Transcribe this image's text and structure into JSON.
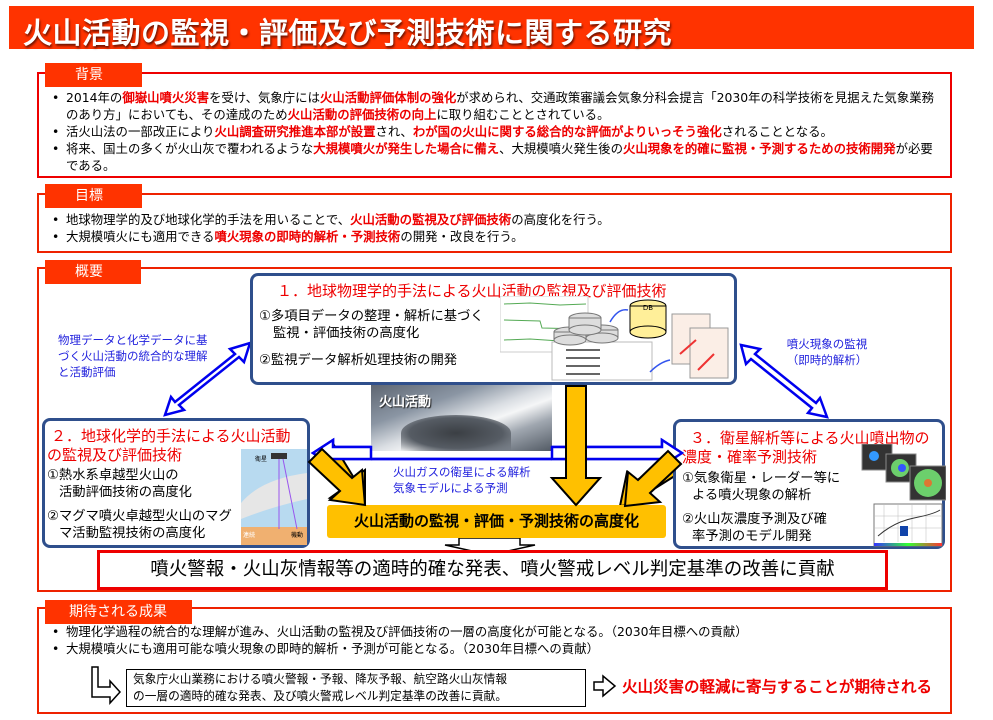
{
  "title": "火山活動の監視・評価及び予測技術に関する研究",
  "colors": {
    "accent": "#ff3300",
    "highlight": "#ee0000",
    "box_border": "#2f4f8c",
    "note_blue": "#2222dd",
    "banner_yellow": "#ffc000"
  },
  "background": {
    "tab": "背景",
    "items": [
      [
        {
          "t": "2014年の"
        },
        {
          "t": "御嶽山噴火災害",
          "hl": true
        },
        {
          "t": "を受け、気象庁には"
        },
        {
          "t": "火山活動評価体制の強化",
          "hl": true
        },
        {
          "t": "が求められ、交通政策審議会気象分科会提言「2030年の科学技術を見据えた気象業務のあり方」においても、その達成のため"
        },
        {
          "t": "火山活動の評価技術の向上",
          "hl": true
        },
        {
          "t": "に取り組むこととされている。"
        }
      ],
      [
        {
          "t": "活火山法の一部改正により"
        },
        {
          "t": "火山調査研究推進本部が設置",
          "hl": true
        },
        {
          "t": "され、"
        },
        {
          "t": "わが国の火山に関する総合的な評価がよりいっそう強化",
          "hl": true
        },
        {
          "t": "されることとなる。"
        }
      ],
      [
        {
          "t": "将来、国土の多くが火山灰で覆われるような"
        },
        {
          "t": "大規模噴火が発生した場合に備え",
          "hl": true
        },
        {
          "t": "、大規模噴火発生後の"
        },
        {
          "t": "火山現象を的確に監視・予測するための技術開発",
          "hl": true
        },
        {
          "t": "が必要である。"
        }
      ]
    ]
  },
  "goals": {
    "tab": "目標",
    "items": [
      [
        {
          "t": "地球物理学的及び地球化学的手法を用いることで、"
        },
        {
          "t": "火山活動の監視及び評価技術",
          "hl": true
        },
        {
          "t": "の高度化を行う。"
        }
      ],
      [
        {
          "t": "大規模噴火にも適用できる"
        },
        {
          "t": "噴火現象の即時的解析・予測技術",
          "hl": true
        },
        {
          "t": "の開発・改良を行う。"
        }
      ]
    ]
  },
  "overview": {
    "tab": "概要",
    "box1": {
      "title": "１．地球物理学的手法による火山活動の監視及び評価技術",
      "item1_line1": "①多項目データの整理・解析に基づく",
      "item1_line2": "監視・評価技術の高度化",
      "item2": "②監視データ解析処理技術の開発",
      "db_label": "DB"
    },
    "box2": {
      "title_line1": "２．地球化学的手法による火山活動",
      "title_line2": "の監視及び評価技術",
      "item1_line1": "①熱水系卓越型火山の",
      "item1_line2": "活動評価技術の高度化",
      "item2_line1": "②マグマ噴火卓越型火山のマグ",
      "item2_line2": "マ活動監視技術の高度化",
      "fig_labels": {
        "satellite": "衛星",
        "continuous": "連続",
        "mobile": "機動"
      }
    },
    "box3": {
      "title_line1": "３．衛星解析等による火山噴出物の",
      "title_line2": "濃度・確率予測技術",
      "item1_line1": "①気象衛星・レーダー等に",
      "item1_line2": "よる噴火現象の解析",
      "item2_line1": "②火山灰濃度予測及び確",
      "item2_line2": "率予測のモデル開発"
    },
    "note_left": "物理データと化学データに基づく火山活動の統合的な理解と活動評価",
    "note_right_line1": "噴火現象の監視",
    "note_right_line2": "（即時的解析）",
    "note_mid_line1": "火山ガスの衛星による解析",
    "note_mid_line2": "気象モデルによる予測",
    "photo_label": "火山活動",
    "banner": "火山活動の監視・評価・予測技術の高度化",
    "outcome": "噴火警報・火山灰情報等の適時的確な発表、噴火警戒レベル判定基準の改善に貢献"
  },
  "results": {
    "tab": "期待される成果",
    "items": [
      "物理化学過程の統合的な理解が進み、火山活動の監視及び評価技術の一層の高度化が可能となる。（2030年目標への貢献）",
      "大規模噴火にも適用可能な噴火現象の即時的解析・予測が可能となる。（2030年目標への貢献）"
    ],
    "contribution_line1": "気象庁火山業務における噴火警報・予報、降灰予報、航空路火山灰情報",
    "contribution_line2": "の一層の適時的確な発表、及び噴火警戒レベル判定基準の改善に貢献。",
    "conclusion": "火山災害の軽減に寄与することが期待される"
  }
}
